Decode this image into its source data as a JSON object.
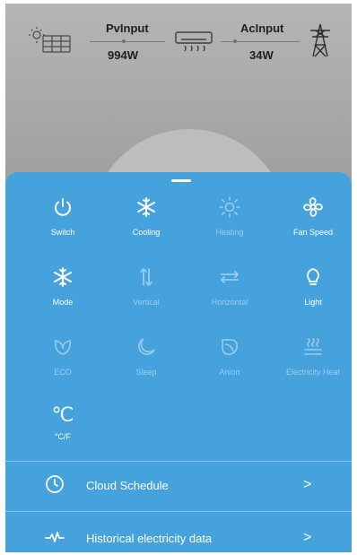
{
  "energy_flow": {
    "pv_label": "PvInput",
    "pv_value": "994W",
    "ac_label": "AcInput",
    "ac_value": "34W"
  },
  "controls": [
    {
      "label": "Switch",
      "icon": "power-icon",
      "enabled": true
    },
    {
      "label": "Cooling",
      "icon": "snowflake-icon",
      "enabled": true
    },
    {
      "label": "Heating",
      "icon": "sun-icon",
      "enabled": false
    },
    {
      "label": "Fan Speed",
      "icon": "fan-icon",
      "enabled": true
    },
    {
      "label": "Mode",
      "icon": "snowflake-icon",
      "enabled": true
    },
    {
      "label": "Vertical",
      "icon": "vertical-swing-icon",
      "enabled": false
    },
    {
      "label": "Horizontal",
      "icon": "horizontal-swing-icon",
      "enabled": false
    },
    {
      "label": "Light",
      "icon": "bulb-icon",
      "enabled": true
    },
    {
      "label": "ECO",
      "icon": "leaf-icon",
      "enabled": false
    },
    {
      "label": "Sleep",
      "icon": "moon-icon",
      "enabled": false
    },
    {
      "label": "Anion",
      "icon": "anion-icon",
      "enabled": false
    },
    {
      "label": "Electricity Heat",
      "icon": "heat-icon",
      "enabled": false
    },
    {
      "label": "°C/F",
      "icon": "celsius-icon",
      "enabled": true,
      "symbol": "℃"
    }
  ],
  "rows": {
    "cloud_schedule": "Cloud Schedule",
    "history": "Historical electricity data",
    "chevron": ">"
  },
  "colors": {
    "panel": "#45a2dd",
    "top_background": "#a3a3a3"
  }
}
